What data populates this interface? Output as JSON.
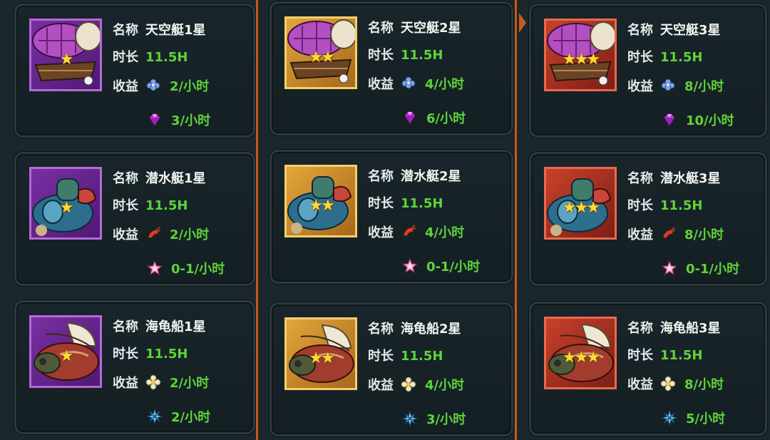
{
  "labels": {
    "name": "名称",
    "duration": "时长",
    "income": "收益"
  },
  "columns": [
    {
      "cards": [
        {
          "name": "天空艇1星",
          "duration": "11.5H",
          "star_icon": "★",
          "rate1": "2/小时",
          "rate2": "3/小时",
          "icon1": "blue-flower-icon",
          "icon2": "purple-gem-icon",
          "frame": "purple"
        },
        {
          "name": "潜水艇1星",
          "duration": "11.5H",
          "star_icon": "★",
          "rate1": "2/小时",
          "rate2": "0-1/小时",
          "icon1": "red-shrimp-icon",
          "icon2": "pink-star-icon",
          "frame": "purple"
        },
        {
          "name": "海龟船1星",
          "duration": "11.5H",
          "star_icon": "★",
          "rate1": "2/小时",
          "rate2": "2/小时",
          "icon1": "white-flower-icon",
          "icon2": "blue-crystal-icon",
          "frame": "purple"
        }
      ]
    },
    {
      "cards": [
        {
          "name": "天空艇2星",
          "duration": "11.5H",
          "star_icon": "★★",
          "rate1": "4/小时",
          "rate2": "6/小时",
          "icon1": "blue-flower-icon",
          "icon2": "purple-gem-icon",
          "frame": "gold"
        },
        {
          "name": "潜水艇2星",
          "duration": "11.5H",
          "star_icon": "★★",
          "rate1": "4/小时",
          "rate2": "0-1/小时",
          "icon1": "red-shrimp-icon",
          "icon2": "pink-star-icon",
          "frame": "gold"
        },
        {
          "name": "海龟船2星",
          "duration": "11.5H",
          "star_icon": "★★",
          "rate1": "4/小时",
          "rate2": "3/小时",
          "icon1": "white-flower-icon",
          "icon2": "blue-crystal-icon",
          "frame": "gold"
        }
      ]
    },
    {
      "cards": [
        {
          "name": "天空艇3星",
          "duration": "11.5H",
          "star_icon": "★★★",
          "rate1": "8/小时",
          "rate2": "10/小时",
          "icon1": "blue-flower-icon",
          "icon2": "purple-gem-icon",
          "frame": "red"
        },
        {
          "name": "潜水艇3星",
          "duration": "11.5H",
          "star_icon": "★★★",
          "rate1": "8/小时",
          "rate2": "0-1/小时",
          "icon1": "red-shrimp-icon",
          "icon2": "pink-star-icon",
          "frame": "red"
        },
        {
          "name": "海龟船3星",
          "duration": "11.5H",
          "star_icon": "★★★",
          "rate1": "8/小时",
          "rate2": "5/小时",
          "icon1": "white-flower-icon",
          "icon2": "blue-crystal-icon",
          "frame": "red"
        }
      ]
    }
  ],
  "colors": {
    "accent": "#c75a1e",
    "value_green": "#5fd33a",
    "star_gold": "#ffd83a"
  }
}
